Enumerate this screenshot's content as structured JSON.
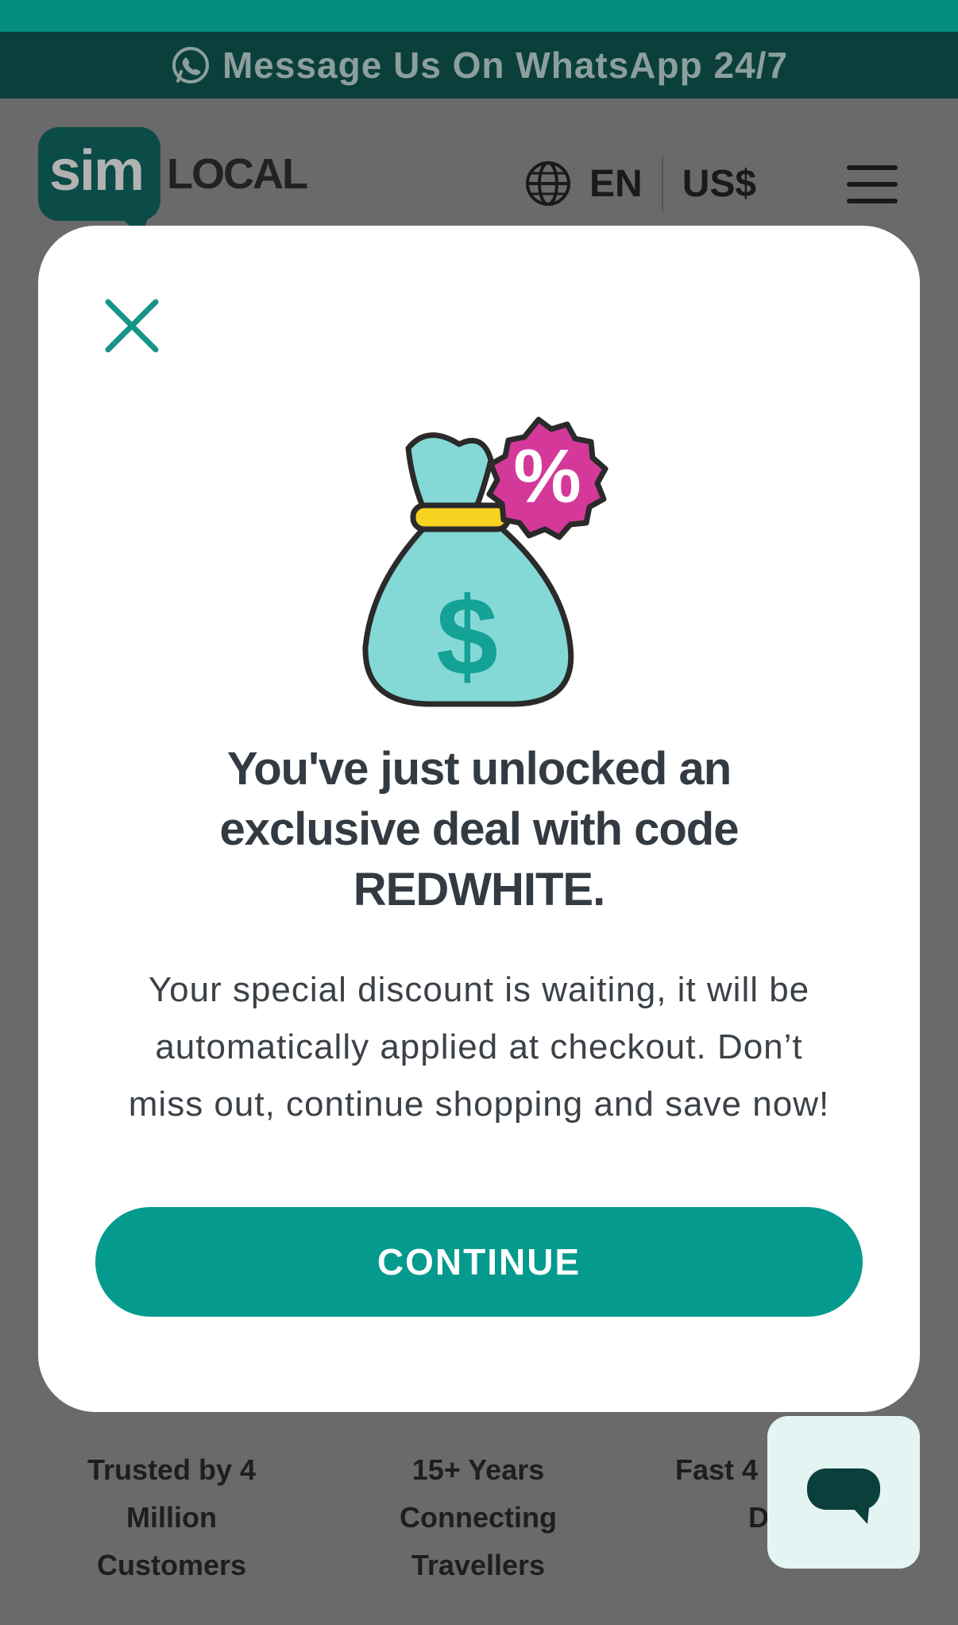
{
  "topbar": {
    "whatsapp_text": "Message Us On WhatsApp 24/7"
  },
  "header": {
    "logo_sim": "sim",
    "logo_local": "LOCAL",
    "language": "EN",
    "currency": "US$"
  },
  "features": [
    {
      "lines": [
        "Trusted by 4",
        "Million",
        "Customers"
      ]
    },
    {
      "lines": [
        "15+ Years",
        "Connecting",
        "Travellers"
      ]
    },
    {
      "lines": [
        "Fast 4",
        "D"
      ]
    }
  ],
  "modal": {
    "badge_symbol": "%",
    "bag_symbol": "$",
    "title_lines": [
      "You've just unlocked an",
      "exclusive deal with code",
      "REDWHITE."
    ],
    "description_lines": [
      "Your special discount is waiting, it will be",
      "automatically applied at checkout. Don’t",
      "miss out, continue shopping and save now!"
    ],
    "continue_label": "CONTINUE"
  },
  "icons": {
    "whatsapp": "whatsapp-icon",
    "globe": "globe-icon",
    "menu": "hamburger-menu-icon",
    "close": "close-icon",
    "chat": "chat-bubble-icon",
    "money_bag": "money-bag-icon"
  },
  "colors": {
    "teal": "#049a8e",
    "teal_dark": "#0b3f3b",
    "badge_pink": "#d4399a",
    "bag_fill": "#84d9d6",
    "title": "#333a41"
  }
}
